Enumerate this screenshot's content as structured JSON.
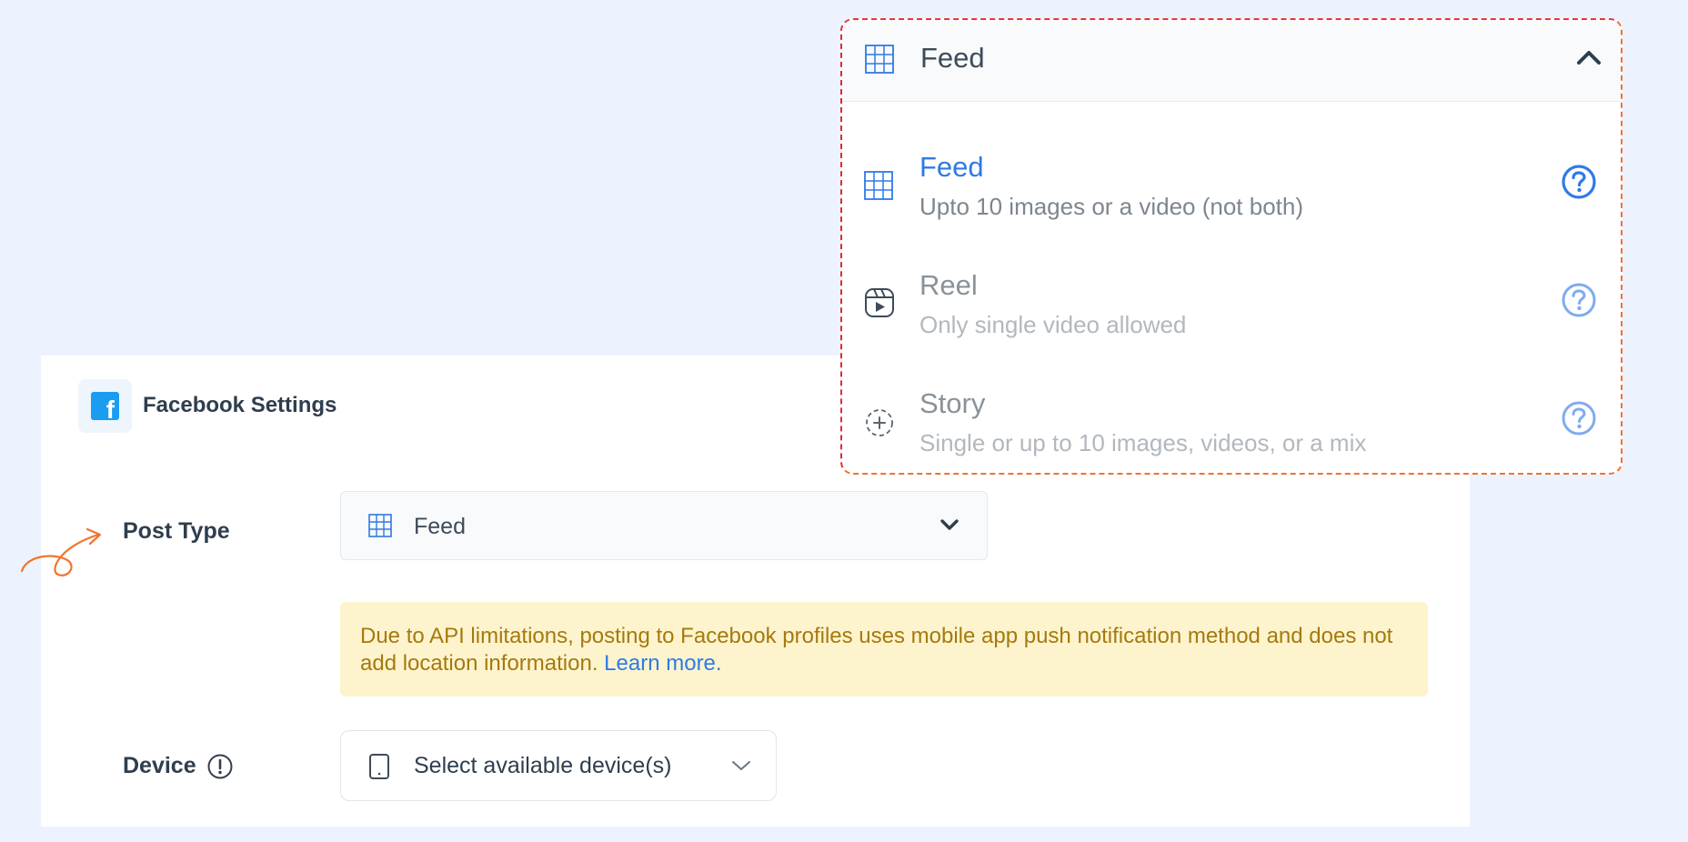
{
  "settings": {
    "title": "Facebook Settings",
    "post_type_label": "Post Type",
    "post_type_value": "Feed",
    "notice_text": "Due to API limitations, posting to Facebook profiles uses mobile app push notification method and does not add location information.",
    "notice_link": "Learn more.",
    "device_label": "Device",
    "device_placeholder": "Select available device(s)"
  },
  "dropdown": {
    "selected": "Feed",
    "options": [
      {
        "title": "Feed",
        "description": "Upto 10 images or a video (not both)",
        "icon": "grid-icon",
        "active": true
      },
      {
        "title": "Reel",
        "description": "Only single video allowed",
        "icon": "reel-icon",
        "active": false
      },
      {
        "title": "Story",
        "description": "Single or up to 10 images, videos, or a mix",
        "icon": "story-icon",
        "active": false
      }
    ]
  },
  "colors": {
    "accent": "#2f7ae5",
    "facebook_blue": "#1a9cf0",
    "notice_bg": "#fdf4cd",
    "notice_text": "#a6790e",
    "page_bg": "#ecf3fe",
    "arrow": "#f2732b"
  }
}
